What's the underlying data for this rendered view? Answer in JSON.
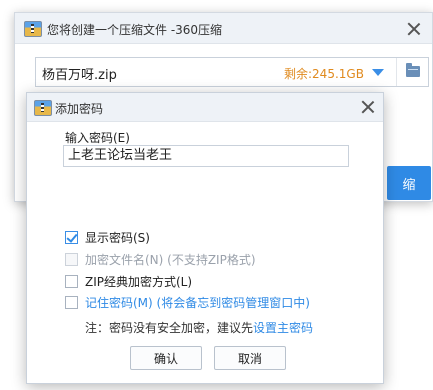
{
  "main_window": {
    "title": "您将创建一个压缩文件 -360压缩",
    "filename": "杨百万呀.zip",
    "free_space": "剩余:245.1GB",
    "start_button_partial": "缩",
    "icons": [
      "app-archive-icon",
      "close-icon",
      "dropdown-arrow-icon",
      "folder-icon"
    ]
  },
  "password_dialog": {
    "title": "添加密码",
    "password_label": "输入密码(E)",
    "password_value": "上老王论坛当老王",
    "options": [
      {
        "label": "显示密码(S)",
        "checked": true,
        "enabled": true
      },
      {
        "label": "加密文件名(N) (不支持ZIP格式)",
        "checked": false,
        "enabled": false
      },
      {
        "label": "ZIP经典加密方式(L)",
        "checked": false,
        "enabled": true
      },
      {
        "label": "记住密码(M) (将会备忘到密码管理窗口中)",
        "checked": false,
        "enabled": true
      }
    ],
    "note_text": "注：密码没有安全加密，建议先",
    "note_link": "设置主密码",
    "ok_label": "确认",
    "cancel_label": "取消"
  },
  "colors": {
    "accent": "#2f8ae5",
    "warning_text": "#e08a1e",
    "disabled_text": "#9aa1ab"
  }
}
